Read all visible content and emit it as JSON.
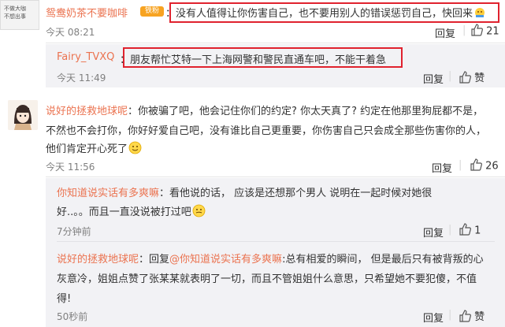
{
  "comments": [
    {
      "avatar_text": "不做大咖\n不想出事",
      "username": "鸳鸯奶茶不要咖啡",
      "badge": "铁粉",
      "text": "没有人值得让你伤害自己，也不要用别人的错误惩罚自己，快回来",
      "time": "今天 08:21",
      "reply": "回复",
      "likes": "21"
    },
    {
      "username": "Fairy_TVXQ",
      "text": "朋友帮忙艾特一下上海网警和警民直通车吧，不能干着急",
      "time": "今天 11:49",
      "reply": "回复",
      "likes": "赞"
    },
    {
      "username": "说好的拯救地球呢",
      "text_line1": "你被骗了吧，他会记住你们的约定? 你太天真了? 约定在他那里狗屁都不是，",
      "text_line2": "不然也不会打你，你好好爱自己吧，没有谁比自己更重要，你伤害自己只会成全那些伤害你的人，",
      "text_line3": "他们肯定开心死了",
      "time": "今天 11:56",
      "reply": "回复",
      "likes": "26"
    }
  ],
  "replies": [
    {
      "username": "你知道说实话有多爽嘛",
      "text_line1": "看他说的话，  应该是还想那个男人  说明在一起时候对她很",
      "text_line2": "好..。。而且一直没说被打过吧",
      "time": "7分钟前",
      "reply": "回复",
      "likes": "1"
    },
    {
      "username": "说好的拯救地球呢",
      "prefix": "回复",
      "mention": "@你知道说实话有多爽嘛",
      "text_line1": ":总有相爱的瞬间，  但是最后只有被背叛的心",
      "text_line2": "灰意冷，姐姐点赞了张某某就表明了一切，而且不管姐姐什么意思，只希望她不要犯傻，不值",
      "text_line3": "得!",
      "time": "50秒前",
      "reply": "回复",
      "likes": "赞"
    }
  ],
  "colors": {
    "username": "#eb7350",
    "highlight": "#e0222e",
    "reply_bg": "#f2f2f5"
  }
}
